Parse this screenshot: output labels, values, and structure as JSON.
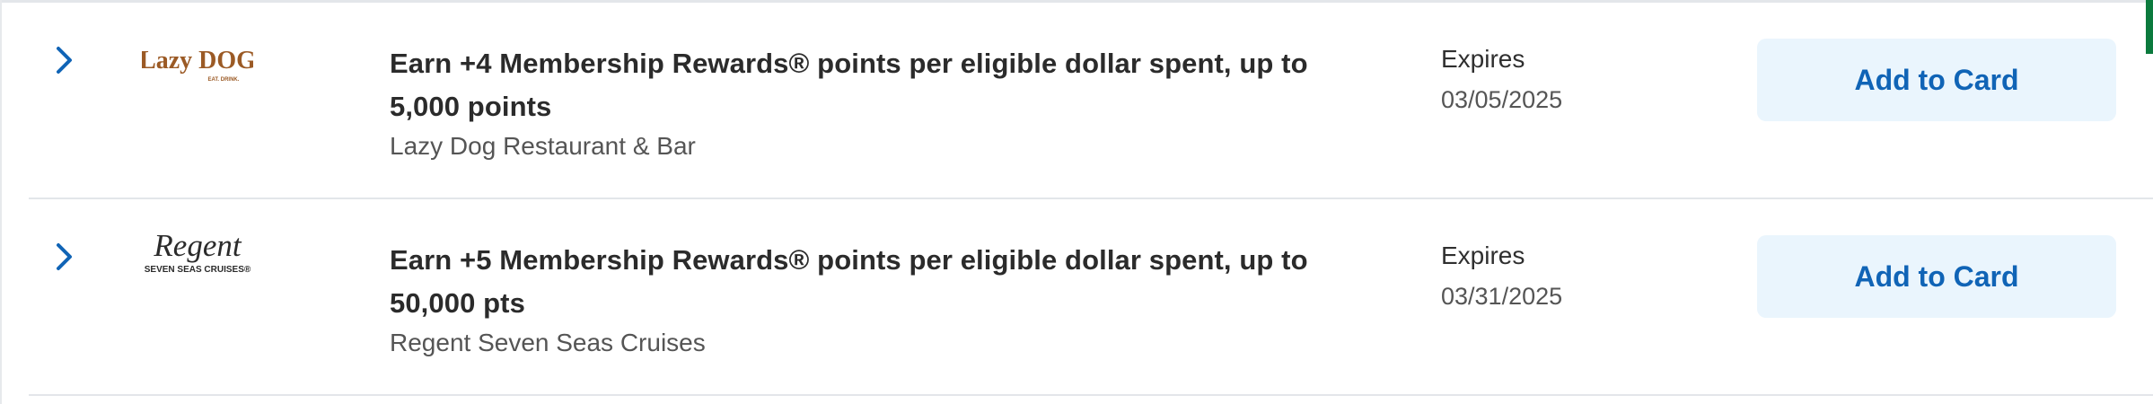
{
  "offers": [
    {
      "title": "Earn +4 Membership Rewards® points per eligible dollar spent, up to 5,000 points",
      "merchant": "Lazy Dog Restaurant & Bar",
      "expires_label": "Expires",
      "expires_date": "03/05/2025",
      "button_label": "Add to Card",
      "logo": {
        "name": "Lazy DOG",
        "tagline": "EAT. DRINK.",
        "color": "#9b5a25"
      }
    },
    {
      "title": "Earn +5 Membership Rewards® points per eligible dollar spent, up to 50,000 pts",
      "merchant": "Regent Seven Seas Cruises",
      "expires_label": "Expires",
      "expires_date": "03/31/2025",
      "button_label": "Add to Card",
      "logo": {
        "name": "Regent",
        "tagline": "SEVEN SEAS CRUISES®",
        "color": "#2b2b2b"
      }
    }
  ],
  "colors": {
    "button_background": "#eaf5fd",
    "button_text": "#1064b6",
    "chevron": "#1064b6",
    "divider": "#e3e6ea"
  },
  "icons": {
    "expand": "chevron-right-icon"
  }
}
